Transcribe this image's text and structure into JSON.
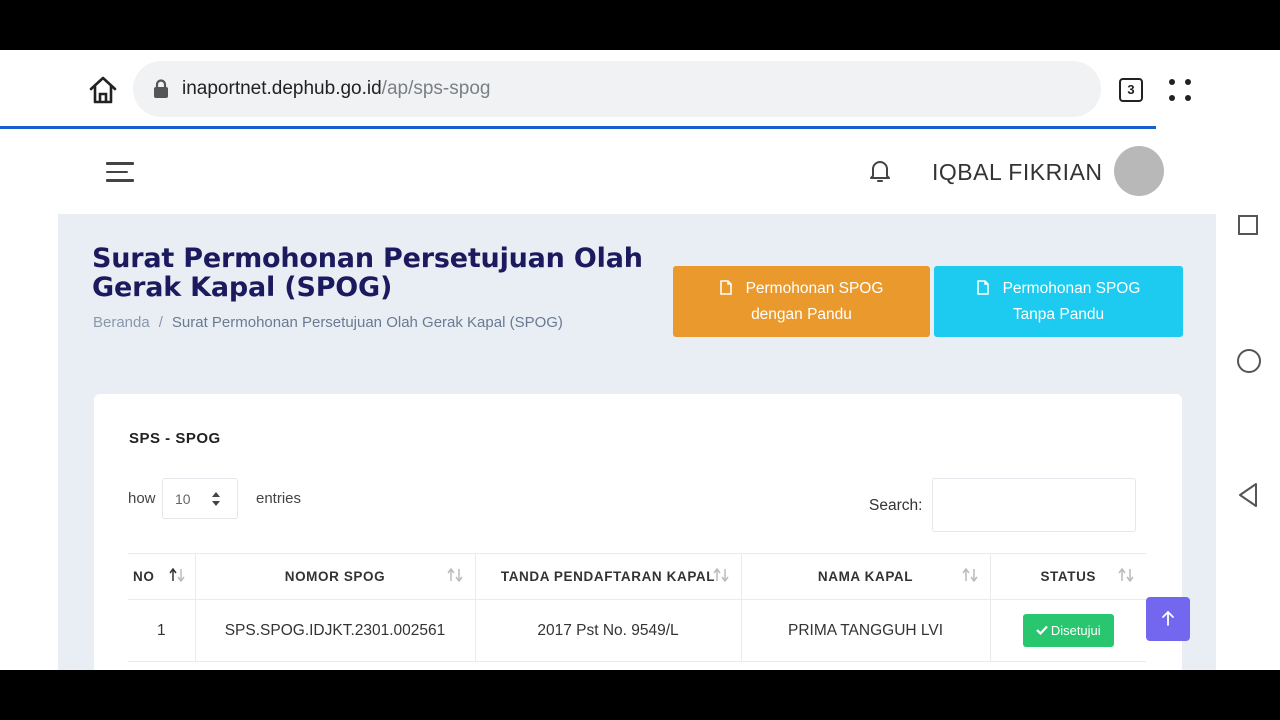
{
  "browser": {
    "url_domain": "inaportnet.dephub.go.id",
    "url_path": "/ap/sps-spog",
    "tab_count": "3"
  },
  "header": {
    "user_name": "IQBAL FIKRIAN"
  },
  "page": {
    "title": "Surat Permohonan Persetujuan Olah Gerak Kapal (SPOG)",
    "breadcrumb": {
      "home": "Beranda",
      "separator": "/",
      "current": "Surat Permohonan Persetujuan Olah Gerak Kapal (SPOG)"
    },
    "buttons": {
      "with_pilot_line1": "Permohonan SPOG",
      "with_pilot_line2": "dengan Pandu",
      "without_pilot_line1": "Permohonan SPOG",
      "without_pilot_line2": "Tanpa Pandu"
    }
  },
  "card": {
    "title": "SPS - SPOG",
    "show_label": "how",
    "length_value": "10",
    "entries_label": "entries",
    "search_label": "Search:",
    "search_value": ""
  },
  "table": {
    "columns": [
      "NO",
      "NOMOR SPOG",
      "TANDA PENDAFTARAN KAPAL",
      "NAMA KAPAL",
      "STATUS"
    ],
    "rows": [
      {
        "no": "1",
        "nomor_spog": "SPS.SPOG.IDJKT.2301.002561",
        "tanda_pendaftaran": "2017 Pst No. 9549/L",
        "nama_kapal": "PRIMA TANGGUH LVI",
        "status": "Disetujui"
      }
    ]
  },
  "colors": {
    "orange_button": "#ea9a2d",
    "cyan_button": "#1ccbef",
    "status_approved": "#28c76f",
    "scroll_top_button": "#7367f0",
    "title": "#1b1a5e"
  },
  "icons": [
    "home-icon",
    "lock-icon",
    "tabs-icon",
    "menu-dots-icon",
    "hamburger-icon",
    "bell-icon",
    "document-icon",
    "sort-icon",
    "check-icon",
    "arrow-up-icon",
    "nav-recents-icon",
    "nav-home-icon",
    "nav-back-icon"
  ]
}
